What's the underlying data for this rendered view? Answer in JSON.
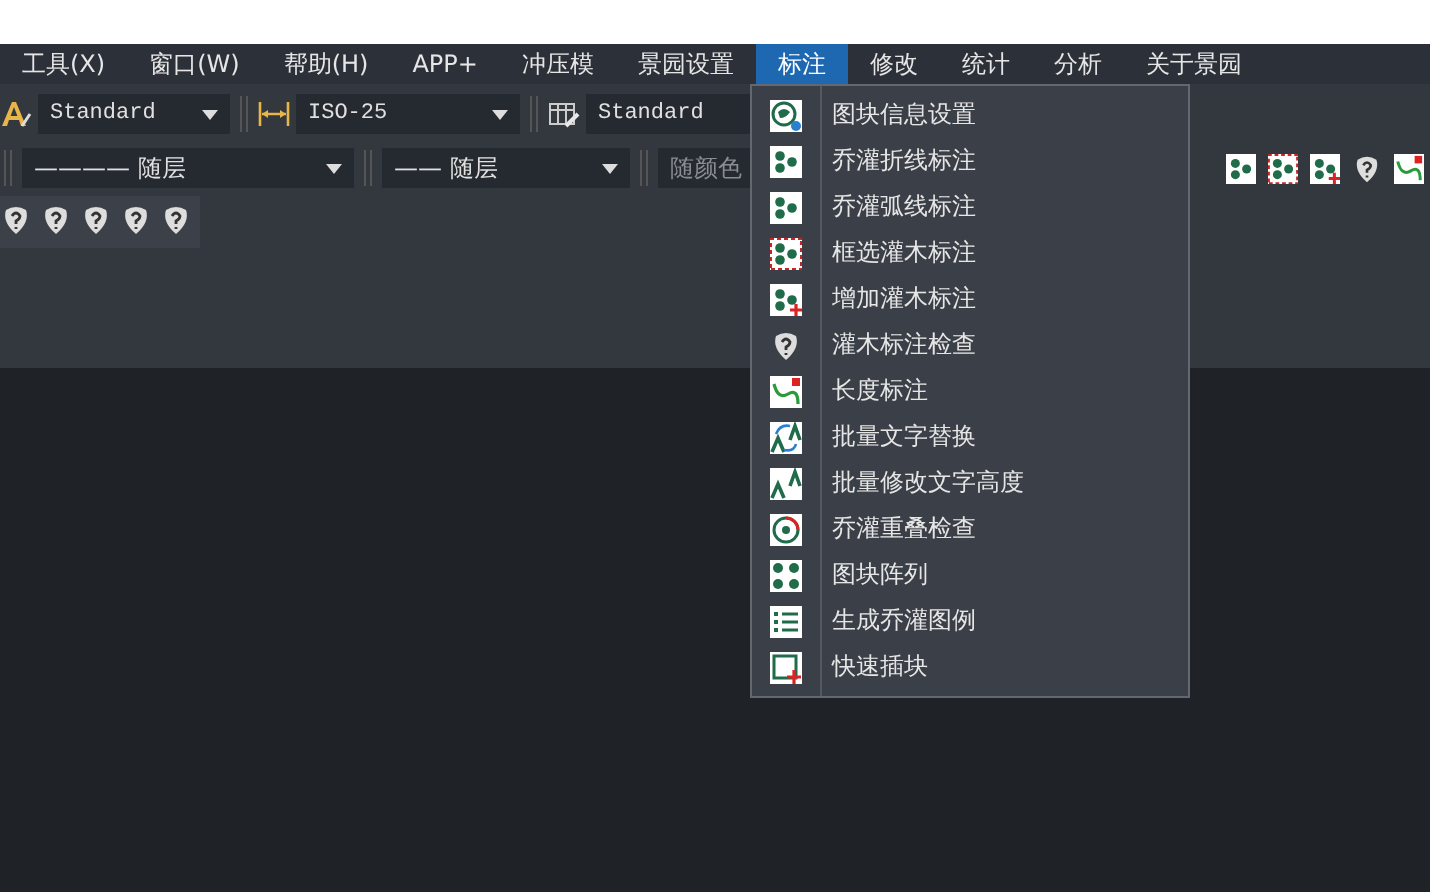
{
  "menu_bar": [
    {
      "label": "工具(X)",
      "selected": false
    },
    {
      "label": "窗口(W)",
      "selected": false
    },
    {
      "label": "帮助(H)",
      "selected": false
    },
    {
      "label": "APP+",
      "selected": false
    },
    {
      "label": "冲压模",
      "selected": false
    },
    {
      "label": "景园设置",
      "selected": false
    },
    {
      "label": "标注",
      "selected": true
    },
    {
      "label": "修改",
      "selected": false
    },
    {
      "label": "统计",
      "selected": false
    },
    {
      "label": "分析",
      "selected": false
    },
    {
      "label": "关于景园",
      "selected": false
    }
  ],
  "toolbar": {
    "text_style": "Standard",
    "dim_style": "ISO-25",
    "table_style": "Standard",
    "linetype": "———— 随层",
    "lineweight": "—— 随层",
    "color_field": "随颜色"
  },
  "dropdown": [
    {
      "label": "图块信息设置"
    },
    {
      "label": "乔灌折线标注"
    },
    {
      "label": "乔灌弧线标注"
    },
    {
      "label": "框选灌木标注"
    },
    {
      "label": "增加灌木标注"
    },
    {
      "label": "灌木标注检查"
    },
    {
      "label": "长度标注"
    },
    {
      "label": "批量文字替换"
    },
    {
      "label": "批量修改文字高度"
    },
    {
      "label": "乔灌重叠检查"
    },
    {
      "label": "图块阵列"
    },
    {
      "label": "生成乔灌图例"
    },
    {
      "label": "快速插块"
    }
  ]
}
